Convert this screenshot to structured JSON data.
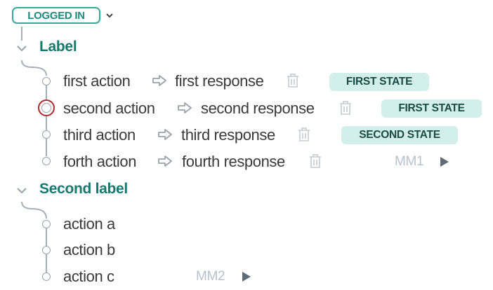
{
  "status_badge": "LOGGED IN",
  "groups": [
    {
      "label": "Label",
      "rows": [
        {
          "action": "first action",
          "response": "first response",
          "state": "FIRST STATE"
        },
        {
          "action": "second action",
          "response": "second response",
          "state": "FIRST STATE"
        },
        {
          "action": "third action",
          "response": "third response",
          "state": "SECOND STATE"
        },
        {
          "action": "forth action",
          "response": "fourth response",
          "marker": "MM1"
        }
      ]
    },
    {
      "label": "Second label",
      "rows": [
        {
          "action": "action a"
        },
        {
          "action": "action b"
        },
        {
          "action": "action c",
          "marker": "MM2"
        }
      ]
    }
  ],
  "icons": {
    "expand": "chevron-down-icon",
    "arrow": "arrow-right-icon",
    "delete": "trash-icon",
    "play": "play-icon"
  },
  "colors": {
    "accent": "#127a6e",
    "badge_bg": "#d3efec",
    "selected": "#b0282e"
  }
}
